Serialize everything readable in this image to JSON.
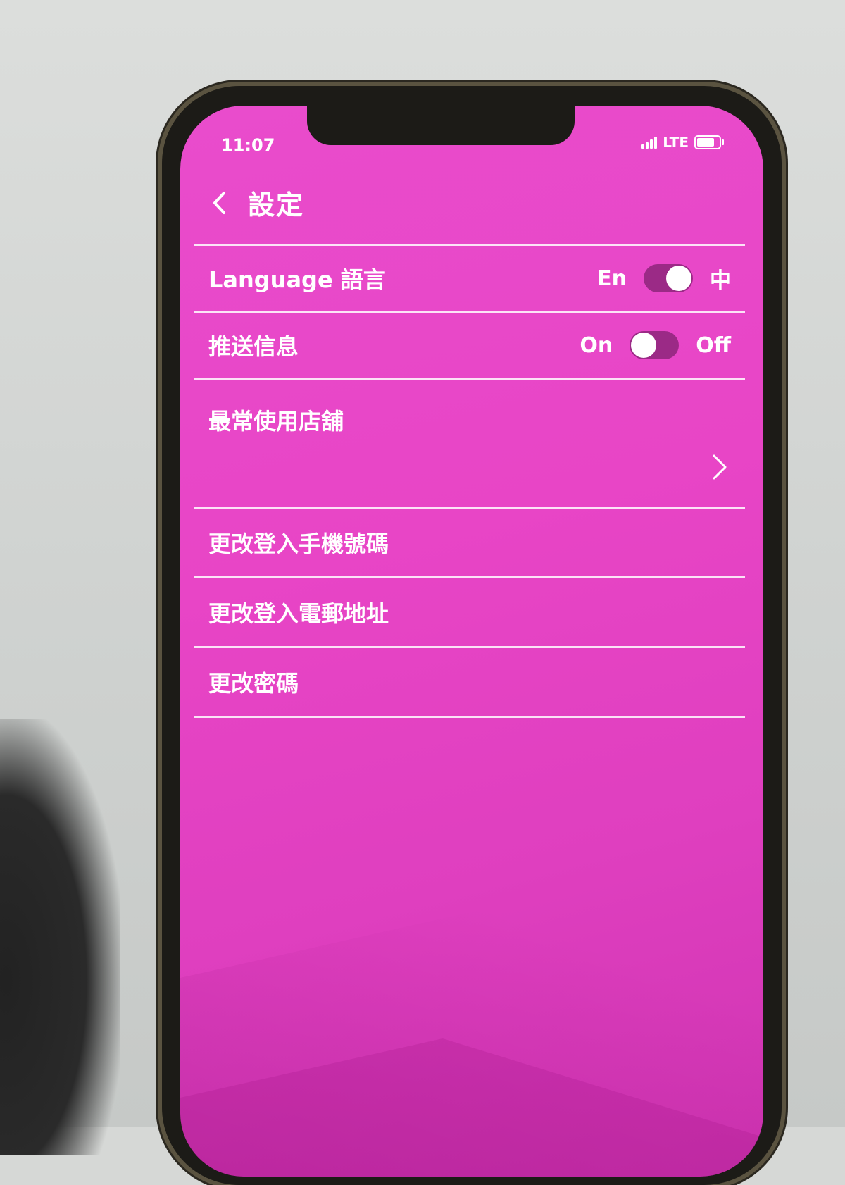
{
  "status_bar": {
    "time": "11:07",
    "network": "LTE"
  },
  "header": {
    "title": "設定"
  },
  "settings": {
    "language": {
      "label": "Language 語言",
      "left_option": "En",
      "right_option": "中",
      "selected": "中"
    },
    "push": {
      "label": "推送信息",
      "left_option": "On",
      "right_option": "Off",
      "selected": "On"
    },
    "favorite_store": {
      "label": "最常使用店舖"
    },
    "change_phone": {
      "label": "更改登入手機號碼"
    },
    "change_email": {
      "label": "更改登入電郵地址"
    },
    "change_password": {
      "label": "更改密碼"
    }
  },
  "colors": {
    "background": "#e845c6",
    "switch_track": "#9b2a86",
    "text": "#ffffff"
  }
}
